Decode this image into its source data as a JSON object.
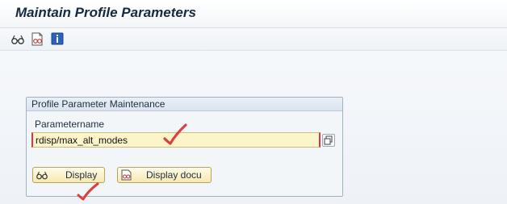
{
  "header": {
    "title": "Maintain Profile Parameters"
  },
  "toolbar": {
    "icons": [
      "glasses-icon",
      "document-glasses-icon",
      "info-icon"
    ]
  },
  "group": {
    "title": "Profile Parameter Maintenance",
    "field_label": "Parametername",
    "field_value": "rdisp/max_alt_modes"
  },
  "buttons": {
    "display_label": "Display",
    "display_docu_label": "Display docu"
  },
  "colors": {
    "title_text": "#15293f",
    "input_bg": "#fbf5c9",
    "required_marker": "#d63a3a",
    "button_bg": "#f6e8b0",
    "annotation_mark": "#d94040"
  }
}
